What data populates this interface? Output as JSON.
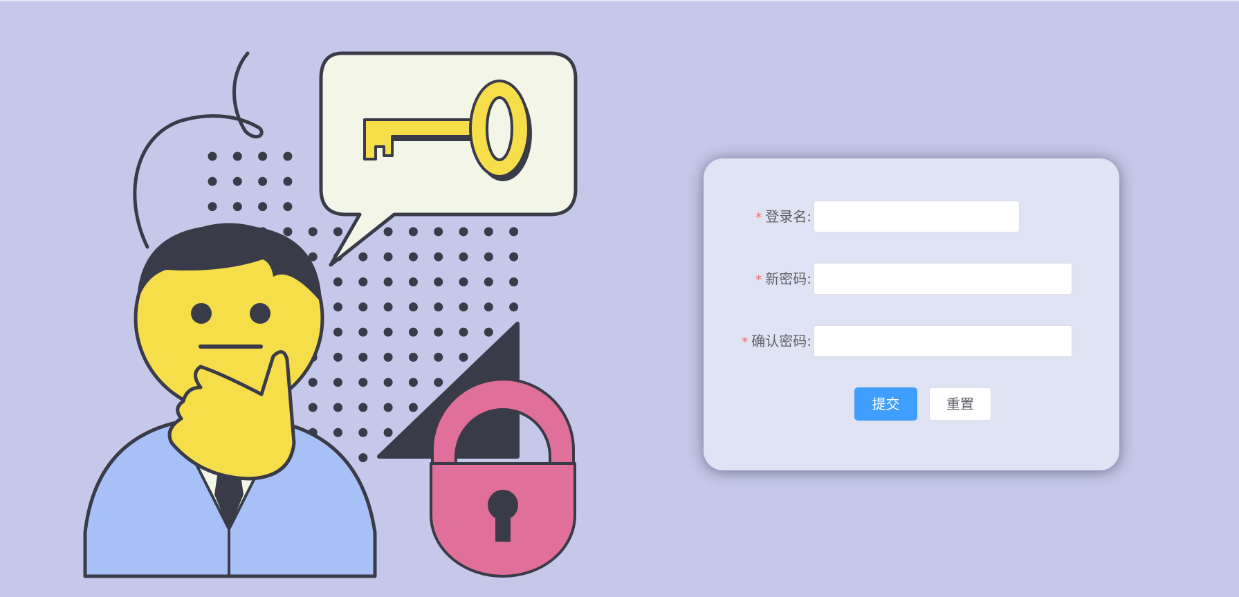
{
  "form": {
    "fields": [
      {
        "required_mark": "*",
        "label": "登录名:",
        "value": "",
        "placeholder": ""
      },
      {
        "required_mark": "*",
        "label": "新密码:",
        "value": "",
        "placeholder": ""
      },
      {
        "required_mark": "*",
        "label": "确认密码:",
        "value": "",
        "placeholder": ""
      }
    ],
    "submit_label": "提交",
    "reset_label": "重置"
  },
  "colors": {
    "background": "#c5c8e8",
    "card": "#e0e3f3",
    "primary": "#409eff",
    "required": "#f56c6c"
  },
  "illustration": {
    "icons": [
      "thinking-person-icon",
      "speech-bubble-icon",
      "key-icon",
      "padlock-icon",
      "dot-pattern",
      "triangle-shape"
    ]
  }
}
